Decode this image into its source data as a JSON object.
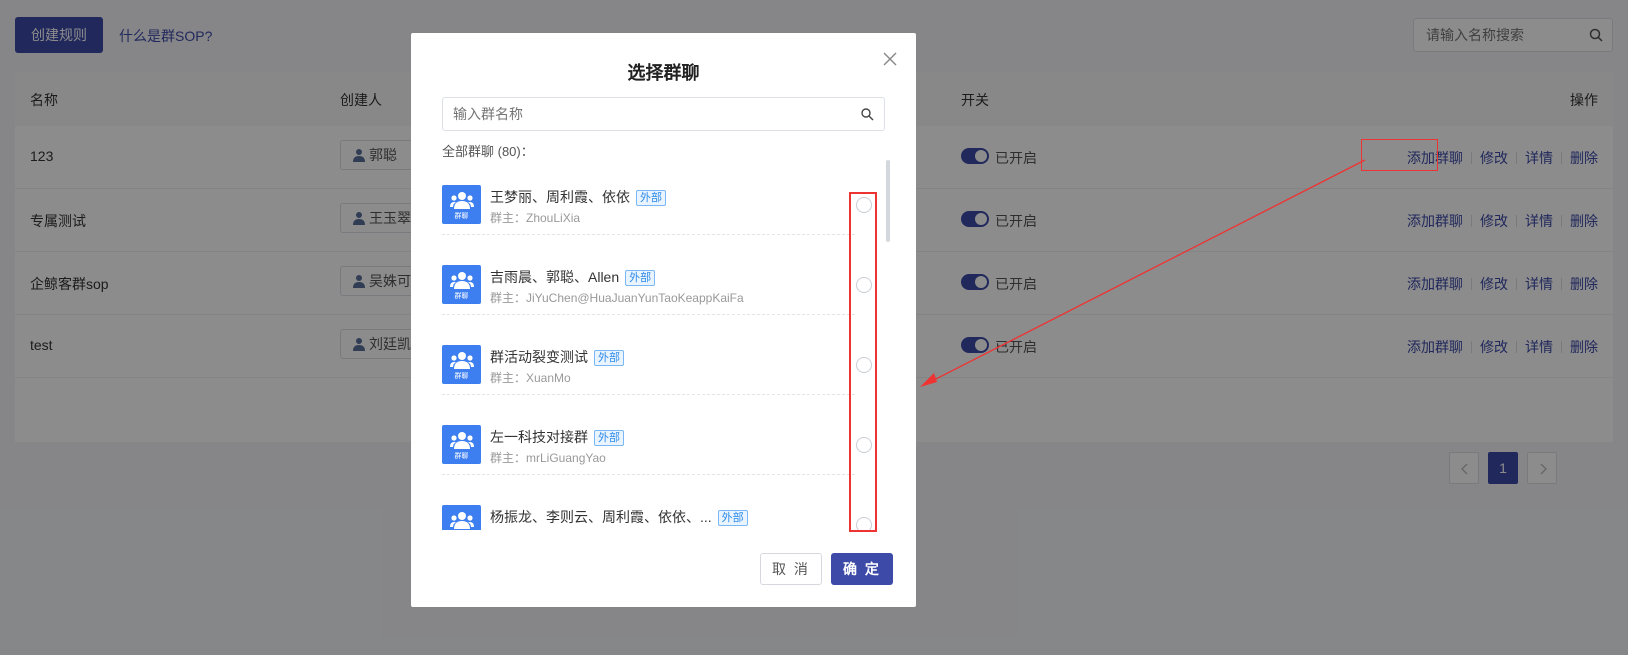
{
  "toolbar": {
    "create_label": "创建规则",
    "help_link": "什么是群SOP?",
    "search_placeholder": "请输入名称搜索"
  },
  "table": {
    "headers": {
      "name": "名称",
      "creator": "创建人",
      "switch": "开关",
      "ops": "操作"
    },
    "rows": [
      {
        "name": "123",
        "creator": "郭聪",
        "status": "已开启"
      },
      {
        "name": "专属测试",
        "creator": "王玉翠",
        "status": "已开启"
      },
      {
        "name": "企鲸客群sop",
        "creator": "吴姝可",
        "status": "已开启"
      },
      {
        "name": "test",
        "creator": "刘廷凯",
        "status": "已开启"
      }
    ],
    "ops": {
      "add": "添加群聊",
      "edit": "修改",
      "detail": "详情",
      "delete": "删除"
    }
  },
  "pagination": {
    "current": "1"
  },
  "modal": {
    "title": "选择群聊",
    "search_placeholder": "输入群名称",
    "count_label": "全部群聊 (80)：",
    "avatar_text": "群聊",
    "tag": "外部",
    "items": [
      {
        "name": "王梦丽、周利霞、依依",
        "owner": "群主：ZhouLiXia"
      },
      {
        "name": "吉雨晨、郭聪、Allen",
        "owner": "群主：JiYuChen@HuaJuanYunTaoKeappKaiFa"
      },
      {
        "name": "群活动裂变测试",
        "owner": "群主：XuanMo"
      },
      {
        "name": "左一科技对接群",
        "owner": "群主：mrLiGuangYao"
      },
      {
        "name": "杨振龙、李则云、周利霞、依依、...",
        "owner": ""
      }
    ],
    "cancel_label": "取 消",
    "ok_label": "确 定"
  },
  "colors": {
    "primary": "#3d4aa8",
    "avatar": "#3d7ff0",
    "annotation": "#ee3333"
  }
}
